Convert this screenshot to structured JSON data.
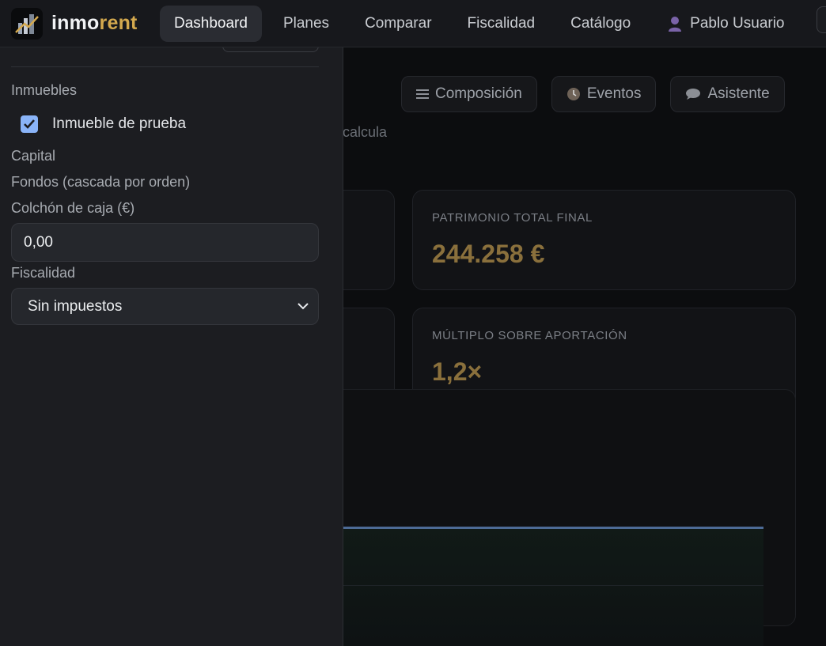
{
  "brand": {
    "name_part1": "inmo",
    "name_part2": "rent",
    "logo_icon": "building-chart-icon",
    "accent": "#d4a94e"
  },
  "nav": {
    "items": [
      {
        "label": "Dashboard",
        "active": true
      },
      {
        "label": "Planes"
      },
      {
        "label": "Comparar"
      },
      {
        "label": "Fiscalidad"
      },
      {
        "label": "Catálogo"
      }
    ],
    "user": {
      "label": "Pablo Usuario",
      "icon": "user-icon"
    }
  },
  "toolbar": {
    "composicion": {
      "label": "Composición",
      "icon": "list-icon"
    },
    "eventos": {
      "label": "Eventos",
      "icon": "clock-icon"
    },
    "asistente": {
      "label": "Asistente",
      "icon": "speech-bubble-icon"
    }
  },
  "background": {
    "subtitle_fragment": "calcula"
  },
  "kpis": [
    {
      "label": "PATRIMONIO TOTAL FINAL",
      "value": "244.258 €"
    },
    {
      "label": "MÚLTIPLO SOBRE APORTACIÓN",
      "value": "1,2×"
    }
  ],
  "drawer": {
    "inmuebles_label": "Inmuebles",
    "property": {
      "label": "Inmueble de prueba",
      "checked": true
    },
    "capital_label": "Capital",
    "fondos_label": "Fondos (cascada por orden)",
    "colchon_label": "Colchón de caja (€)",
    "colchon_value": "0,00",
    "fiscalidad_label": "Fiscalidad",
    "fiscalidad_value": "Sin impuestos"
  }
}
